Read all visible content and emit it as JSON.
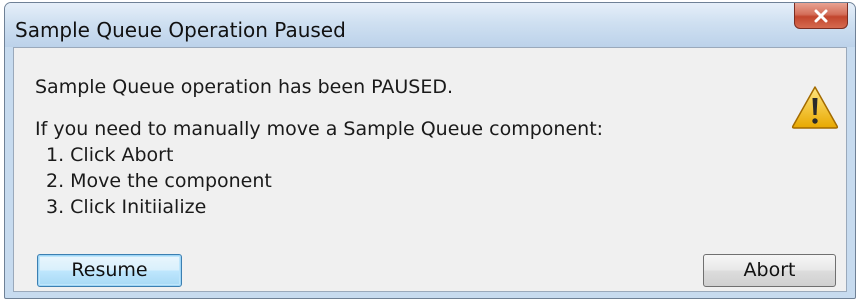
{
  "window": {
    "title": "Sample Queue Operation Paused"
  },
  "message": {
    "status": "Sample Queue operation has been PAUSED.",
    "instruction": "If you need to manually move a Sample Queue component:",
    "steps": [
      "1. Click Abort",
      "2. Move the component",
      "3. Click Initiialize"
    ]
  },
  "buttons": {
    "resume_label": "Resume",
    "abort_label": "Abort"
  },
  "icons": {
    "close": "close-icon",
    "warning": "warning-icon"
  },
  "colors": {
    "titlebar": "#cfe0f1",
    "close_button": "#c2462e",
    "warning_fill": "#f5c518",
    "default_button": "#bee6fd"
  }
}
